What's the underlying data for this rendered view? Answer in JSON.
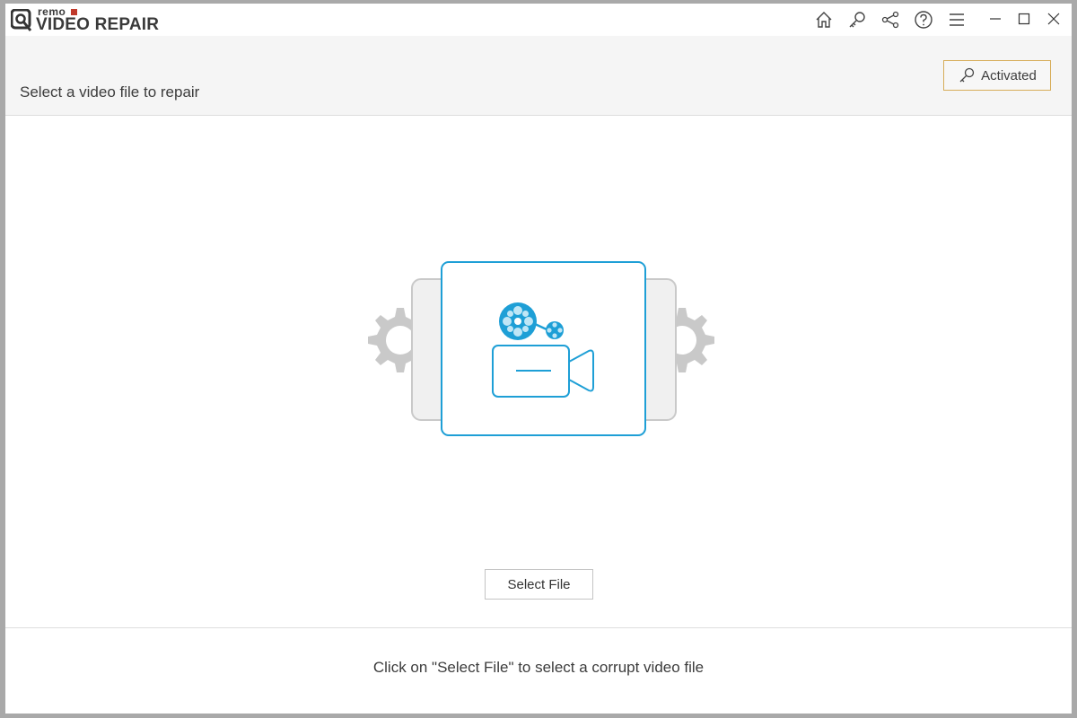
{
  "app": {
    "logo_small": "remo",
    "logo_main": "VIDEO REPAIR"
  },
  "toolbar": {
    "icons": [
      "home-icon",
      "key-icon",
      "share-icon",
      "help-icon",
      "menu-icon"
    ],
    "window_controls": [
      "minimize-icon",
      "maximize-icon",
      "close-icon"
    ]
  },
  "header": {
    "title": "Select a video file to repair",
    "activated_label": "Activated"
  },
  "main": {
    "illustration": "video-repair-illustration",
    "select_button_label": "Select File"
  },
  "footer": {
    "hint": "Click on \"Select File\" to select a corrupt video file"
  },
  "colors": {
    "accent": "#1e9fd6",
    "activated_border": "#d7ad5a",
    "gear": "#c9c9c9"
  }
}
